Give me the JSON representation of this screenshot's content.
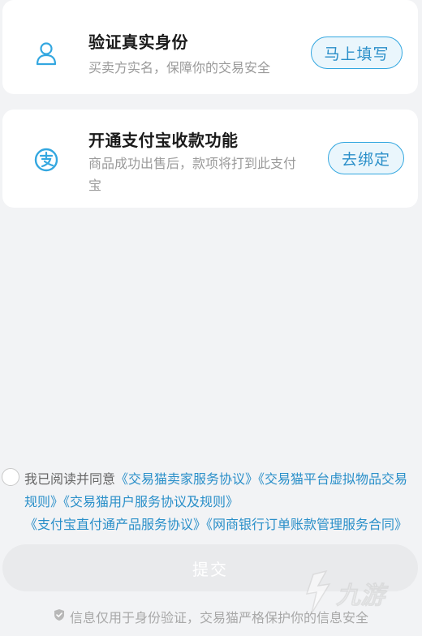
{
  "cards": {
    "identity": {
      "icon": "user-icon",
      "title": "验证真实身份",
      "description": "买卖方实名，保障你的交易安全",
      "button_label": "马上填写"
    },
    "alipay": {
      "icon": "alipay-icon",
      "title": "开通支付宝收款功能",
      "description": "商品成功出售后，款项将打到此支付宝",
      "button_label": "去绑定"
    }
  },
  "agreement": {
    "prefix": "我已阅读并同意",
    "links": [
      "《交易猫卖家服务协议》",
      "《交易猫平台虚拟物品交易规则》",
      "《交易猫用户服务协议及规则》",
      "《支付宝直付通产品服务协议》",
      "《网商银行订单账款管理服务合同》"
    ],
    "checked": false
  },
  "submit": {
    "label": "提交"
  },
  "footer": {
    "icon": "shield-icon",
    "text": "信息仅用于身份验证，交易猫严格保护你的信息安全"
  },
  "watermark": {
    "icon": "jiuyou-logo-icon",
    "text": "九游"
  },
  "colors": {
    "accent": "#2a8fc9",
    "accent_border": "#33a7e0",
    "button_bg": "#eaf6fc",
    "page_bg": "#f2f3f5",
    "submit_disabled_bg": "#e9eaec"
  }
}
